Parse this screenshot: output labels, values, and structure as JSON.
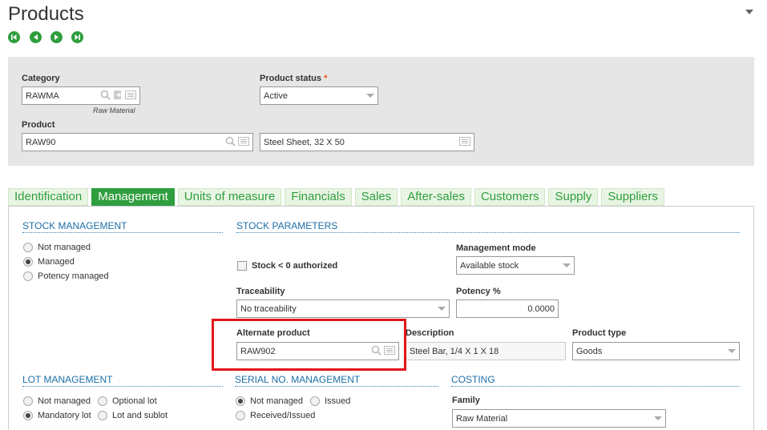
{
  "page": {
    "title": "Products"
  },
  "header": {
    "category": {
      "label": "Category",
      "value": "RAWMA",
      "hint": "Raw Material"
    },
    "product_status": {
      "label": "Product status",
      "required_mark": "*",
      "value": "Active"
    },
    "product": {
      "label": "Product",
      "value": "RAW90",
      "description": "Steel Sheet, 32 X 50"
    }
  },
  "tabs": [
    {
      "label": "Identification",
      "active": false
    },
    {
      "label": "Management",
      "active": true
    },
    {
      "label": "Units of measure",
      "active": false
    },
    {
      "label": "Financials",
      "active": false
    },
    {
      "label": "Sales",
      "active": false
    },
    {
      "label": "After-sales",
      "active": false
    },
    {
      "label": "Customers",
      "active": false
    },
    {
      "label": "Supply",
      "active": false
    },
    {
      "label": "Suppliers",
      "active": false
    }
  ],
  "stock_management": {
    "title": "STOCK MANAGEMENT",
    "options": [
      {
        "label": "Not managed",
        "selected": false
      },
      {
        "label": "Managed",
        "selected": true
      },
      {
        "label": "Potency managed",
        "selected": false
      }
    ]
  },
  "stock_parameters": {
    "title": "STOCK PARAMETERS",
    "negative_stock": {
      "label": "Stock < 0 authorized",
      "checked": false
    },
    "management_mode": {
      "label": "Management mode",
      "value": "Available stock"
    },
    "traceability": {
      "label": "Traceability",
      "value": "No traceability"
    },
    "potency": {
      "label": "Potency %",
      "value": "0.0000"
    },
    "alternate_product": {
      "label": "Alternate product",
      "value": "RAW902"
    },
    "description": {
      "label": "Description",
      "value": "Steel Bar, 1/4 X 1 X 18"
    },
    "product_type": {
      "label": "Product type",
      "value": "Goods"
    }
  },
  "lot_management": {
    "title": "LOT MANAGEMENT",
    "options": [
      {
        "label": "Not managed",
        "selected": false
      },
      {
        "label": "Optional lot",
        "selected": false
      },
      {
        "label": "Mandatory lot",
        "selected": true
      },
      {
        "label": "Lot and sublot",
        "selected": false
      }
    ]
  },
  "serial_management": {
    "title": "SERIAL NO. MANAGEMENT",
    "options": [
      {
        "label": "Not managed",
        "selected": true
      },
      {
        "label": "Issued",
        "selected": false
      },
      {
        "label": "Received/Issued",
        "selected": false
      }
    ]
  },
  "costing": {
    "title": "COSTING",
    "family": {
      "label": "Family",
      "value": "Raw Material"
    }
  },
  "colors": {
    "accent_green": "#2f9e3e",
    "section_blue": "#1c6fa8",
    "highlight_red": "#e3151a"
  }
}
